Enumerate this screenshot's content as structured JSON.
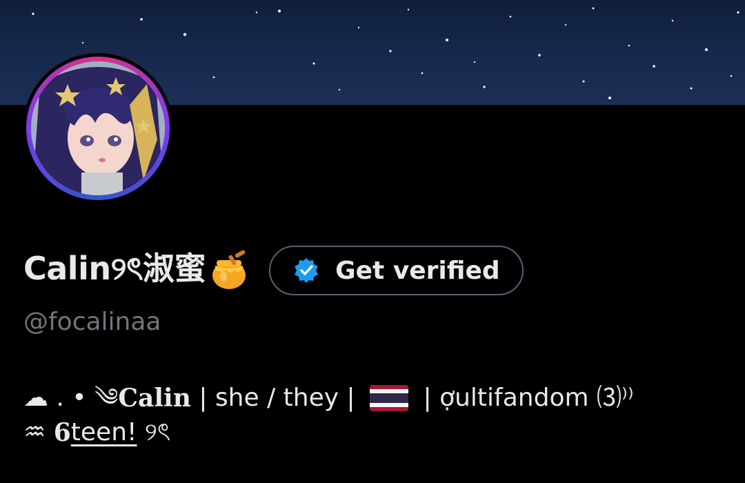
{
  "profile": {
    "display_name": "Calin୨ৎ淑蜜",
    "name_emoji_icon": "honey-pot-icon",
    "handle": "@focalinaa",
    "verify_button": {
      "label": "Get verified",
      "icon": "verified-badge-icon",
      "accent_color": "#1d9bf0"
    },
    "bio": {
      "line1_prefix": "☁︎ . • ༄",
      "line1_name": "Calin",
      "line1_middle": " | she / they | ",
      "line1_flag": "thailand-flag-icon",
      "line1_suffix": " | ợultifandom ⑶⁾⁾",
      "line2_prefix": "♒ ",
      "line2_age_a": "6",
      "line2_age_b": "teen!",
      "line2_suffix": " ୨ৎ"
    }
  },
  "colors": {
    "background": "#000000",
    "text_primary": "#e7e9ea",
    "text_secondary": "#71767b",
    "button_border": "#536471"
  }
}
